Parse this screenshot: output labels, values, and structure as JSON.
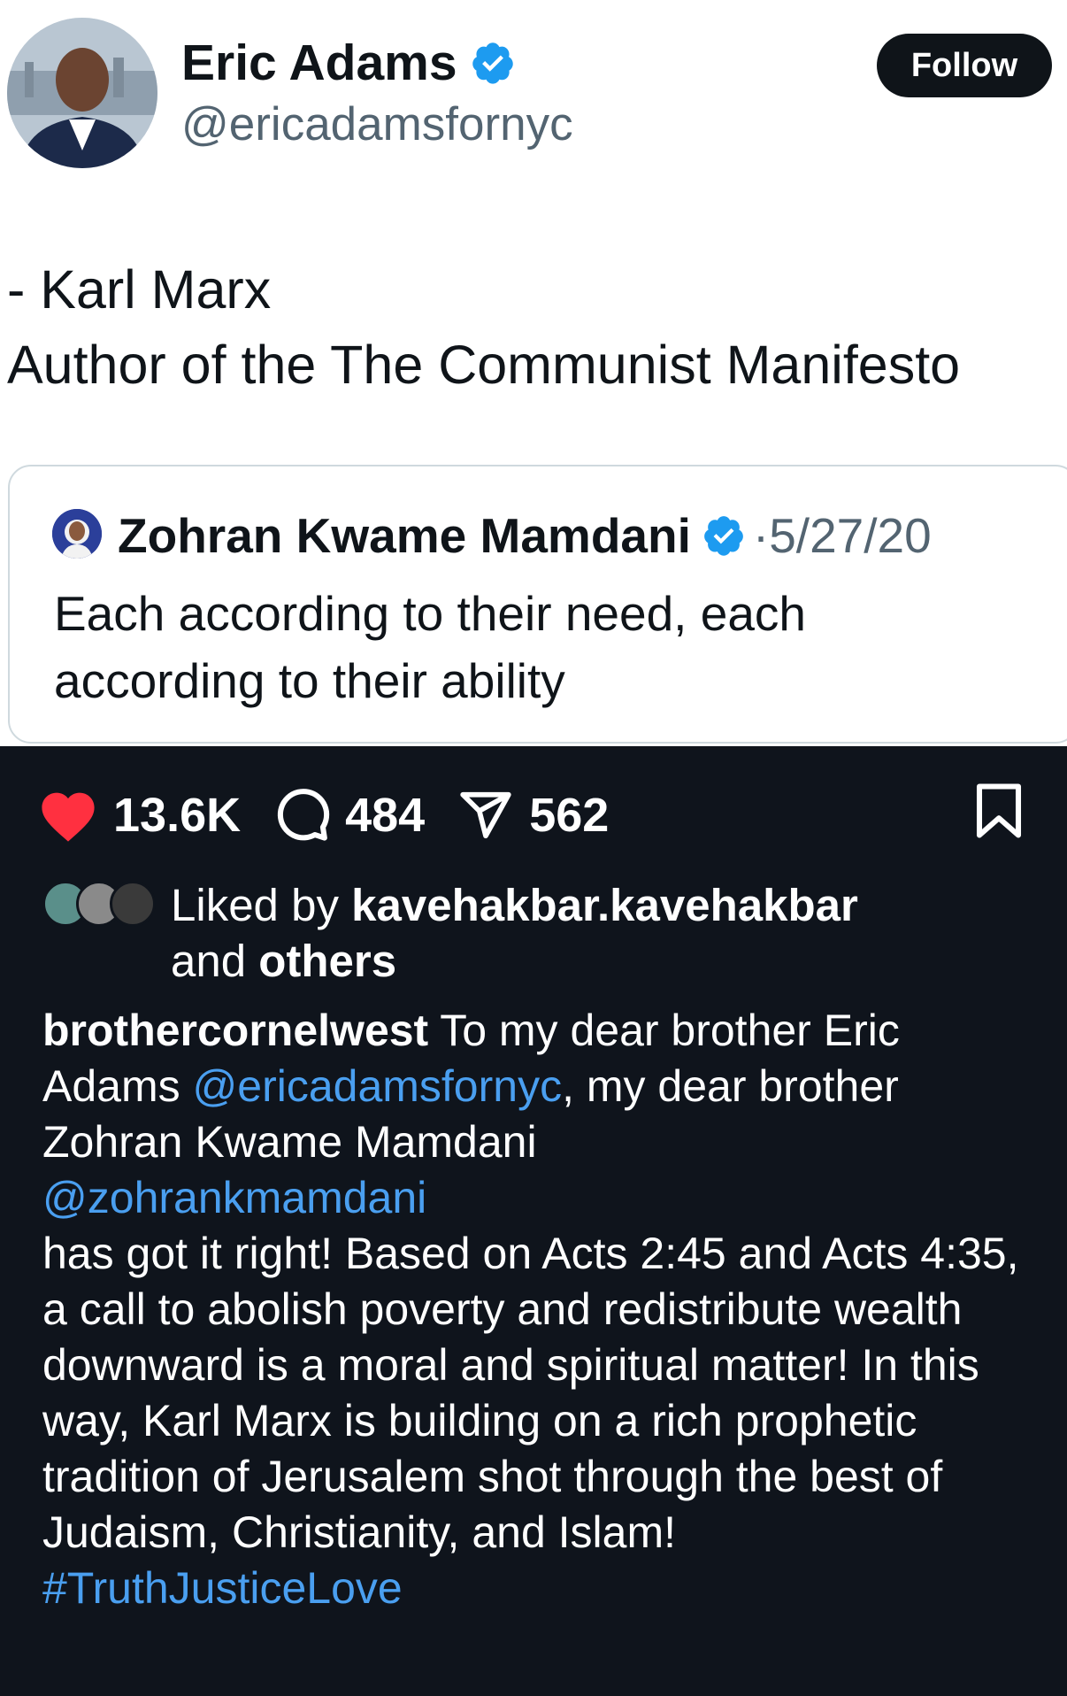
{
  "post": {
    "author_name": "Eric Adams",
    "author_handle": "@ericadamsfornyc",
    "follow_label": "Follow",
    "text_line1": "- Karl Marx",
    "text_line2": "Author of the The Communist Manifesto"
  },
  "quote": {
    "author_name": "Zohran Kwame Mamdani",
    "date": "·5/27/20",
    "text_line1": "Each according to their need, each",
    "text_line2": "according to their ability"
  },
  "stats": {
    "likes": "13.6K",
    "comments": "484",
    "shares": "562"
  },
  "liked_by": {
    "prefix": "Liked by ",
    "user": "kavehakbar.kavehakbar",
    "middle": "and ",
    "others": "others"
  },
  "caption": {
    "username": "brothercornelwest",
    "part1": " To my dear brother Eric Adams ",
    "mention1": "@ericadamsfornyc",
    "part2": ", my dear brother Zohran Kwame Mamdani",
    "mention2": "@zohrankmamdani",
    "part3": "has got it right! Based on Acts 2:45 and Acts 4:35, a call to abolish poverty and redistribute wealth downward is a moral and spiritual matter! In this way, Karl Marx is building on a rich prophetic tradition of Jerusalem shot through the best of Judaism, Christianity, and Islam!",
    "hashtag": "#TruthJusticeLove"
  },
  "colors": {
    "verified": "#1d9bf0",
    "heart": "#ff3040",
    "link": "#4a9ff0",
    "dark_bg": "#0f141c"
  },
  "icons": [
    "verified-badge-icon",
    "heart-icon",
    "comment-icon",
    "share-icon",
    "bookmark-icon"
  ]
}
